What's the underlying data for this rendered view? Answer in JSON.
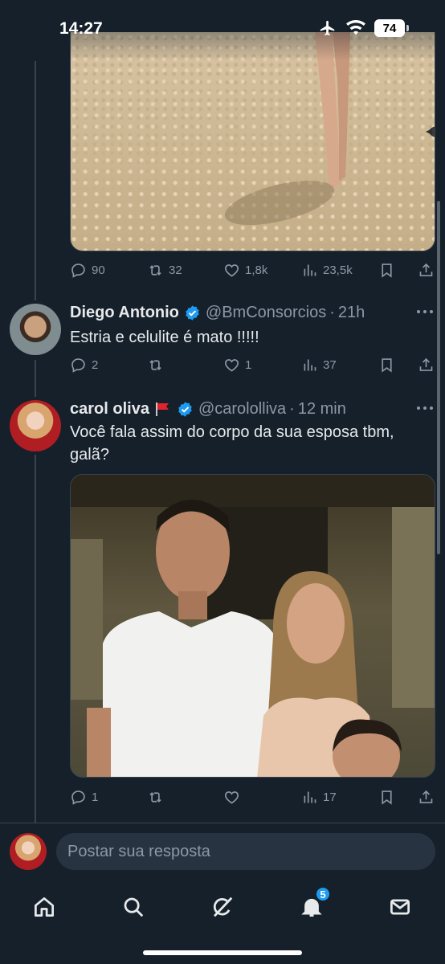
{
  "status_bar": {
    "time": "14:27",
    "battery": "74"
  },
  "top_tweet": {
    "actions": {
      "replies": "90",
      "retweets": "32",
      "likes": "1,8k",
      "views": "23,5k"
    }
  },
  "tweets": [
    {
      "name": "Diego Antonio",
      "handle": "@BmConsorcios",
      "time": "21h",
      "text": "Estria e celulite é mato !!!!!",
      "actions": {
        "replies": "2",
        "retweets": "",
        "likes": "1",
        "views": "37"
      }
    },
    {
      "name": "carol oliva",
      "handle": "@carololliva",
      "time": "12 min",
      "text": "Você fala assim do corpo da sua esposa tbm, galã?",
      "actions": {
        "replies": "1",
        "retweets": "",
        "likes": "",
        "views": "17"
      }
    }
  ],
  "composer": {
    "placeholder": "Postar sua resposta"
  },
  "tabbar": {
    "notifications_badge": "5"
  },
  "colors": {
    "background": "#15202b",
    "accent": "#1d9bf0",
    "muted": "#8b98a5"
  }
}
